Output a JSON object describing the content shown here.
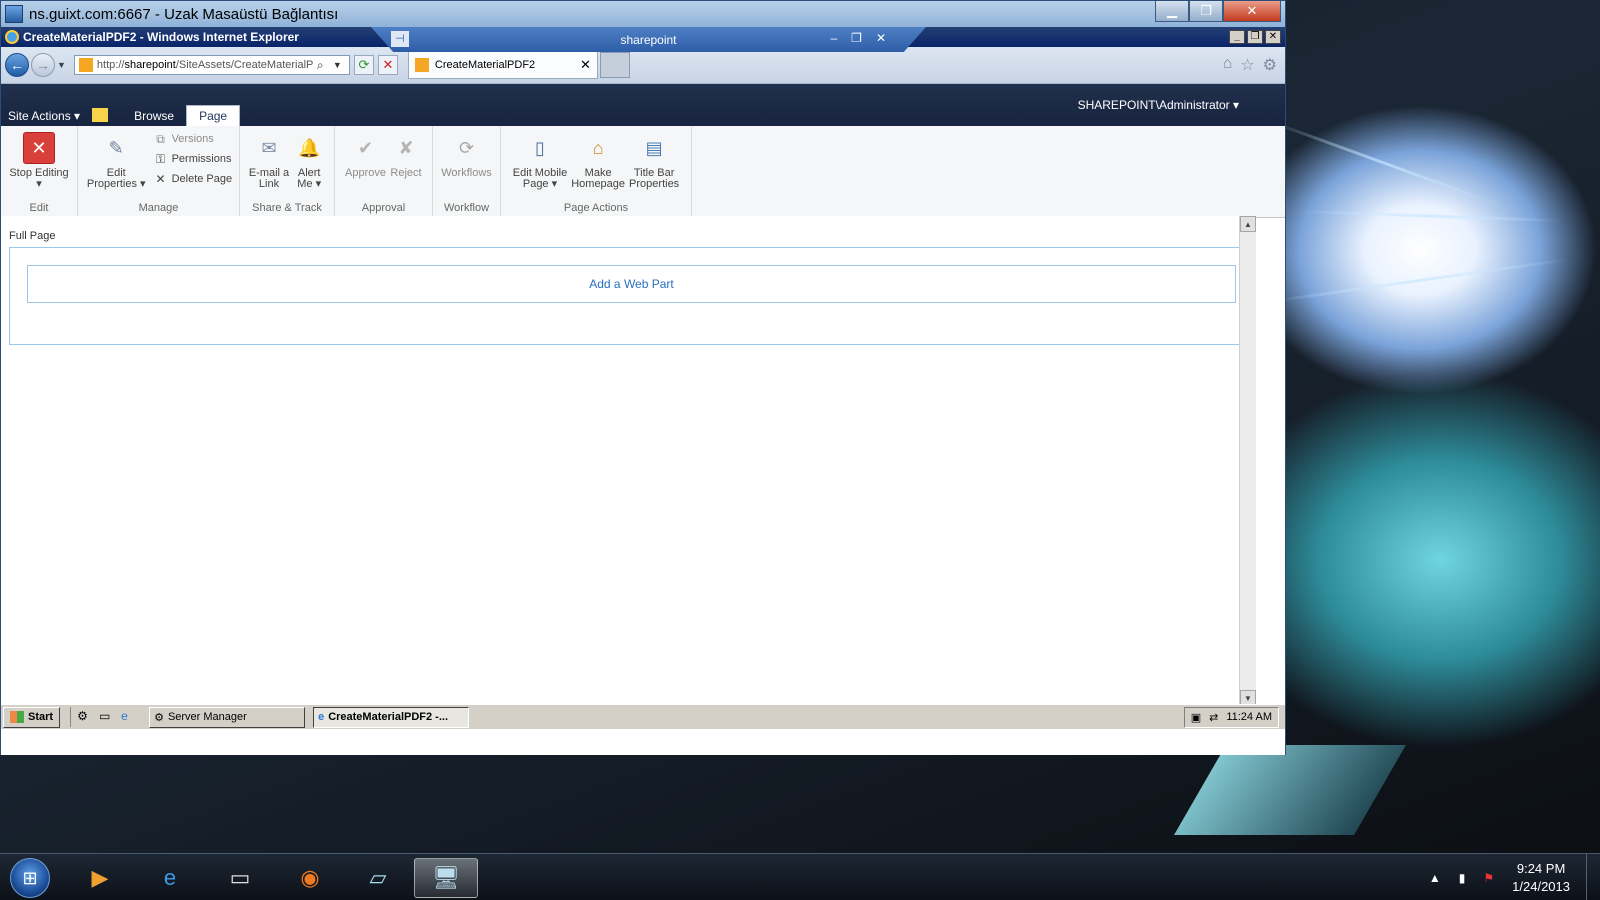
{
  "rdp": {
    "title": "ns.guixt.com:6667 - Uzak Masaüstü Bağlantısı",
    "connection_bar_label": "sharepoint",
    "pin_label": "⊣"
  },
  "ie": {
    "window_title": "CreateMaterialPDF2 - Windows Internet Explorer",
    "address_prefix": "http://",
    "address_host": "sharepoint",
    "address_path": "/SiteAssets/CreateMaterialP",
    "tab_label": "CreateMaterialPDF2"
  },
  "sharepoint": {
    "site_actions": "Site Actions",
    "tabs": [
      {
        "label": "Browse"
      },
      {
        "label": "Page"
      }
    ],
    "user": "SHAREPOINT\\Administrator",
    "ribbon": {
      "groups": [
        {
          "label": "Edit"
        },
        {
          "label": "Manage"
        },
        {
          "label": "Share & Track"
        },
        {
          "label": "Approval"
        },
        {
          "label": "Workflow"
        },
        {
          "label": "Page Actions"
        }
      ],
      "stop_editing": "Stop Editing",
      "edit_properties_1": "Edit",
      "edit_properties_2": "Properties",
      "versions": "Versions",
      "permissions": "Permissions",
      "delete_page": "Delete Page",
      "email_link_1": "E-mail a",
      "email_link_2": "Link",
      "alert_me_1": "Alert",
      "alert_me_2": "Me",
      "approve": "Approve",
      "reject": "Reject",
      "workflows": "Workflows",
      "edit_mobile_1": "Edit Mobile",
      "edit_mobile_2": "Page",
      "make_home_1": "Make",
      "make_home_2": "Homepage",
      "title_bar_1": "Title Bar",
      "title_bar_2": "Properties"
    },
    "zone_label": "Full Page",
    "add_web_part": "Add a Web Part"
  },
  "remote_taskbar": {
    "start": "Start",
    "buttons": [
      {
        "label": "Server Manager"
      },
      {
        "label": "CreateMaterialPDF2 -..."
      }
    ],
    "time": "11:24 AM"
  },
  "host_taskbar": {
    "time": "9:24 PM",
    "date": "1/24/2013"
  },
  "colors": {
    "sp_top": "#21304d",
    "ribbon_bg": "#f5f6f7",
    "link_blue": "#2a6fbd"
  }
}
